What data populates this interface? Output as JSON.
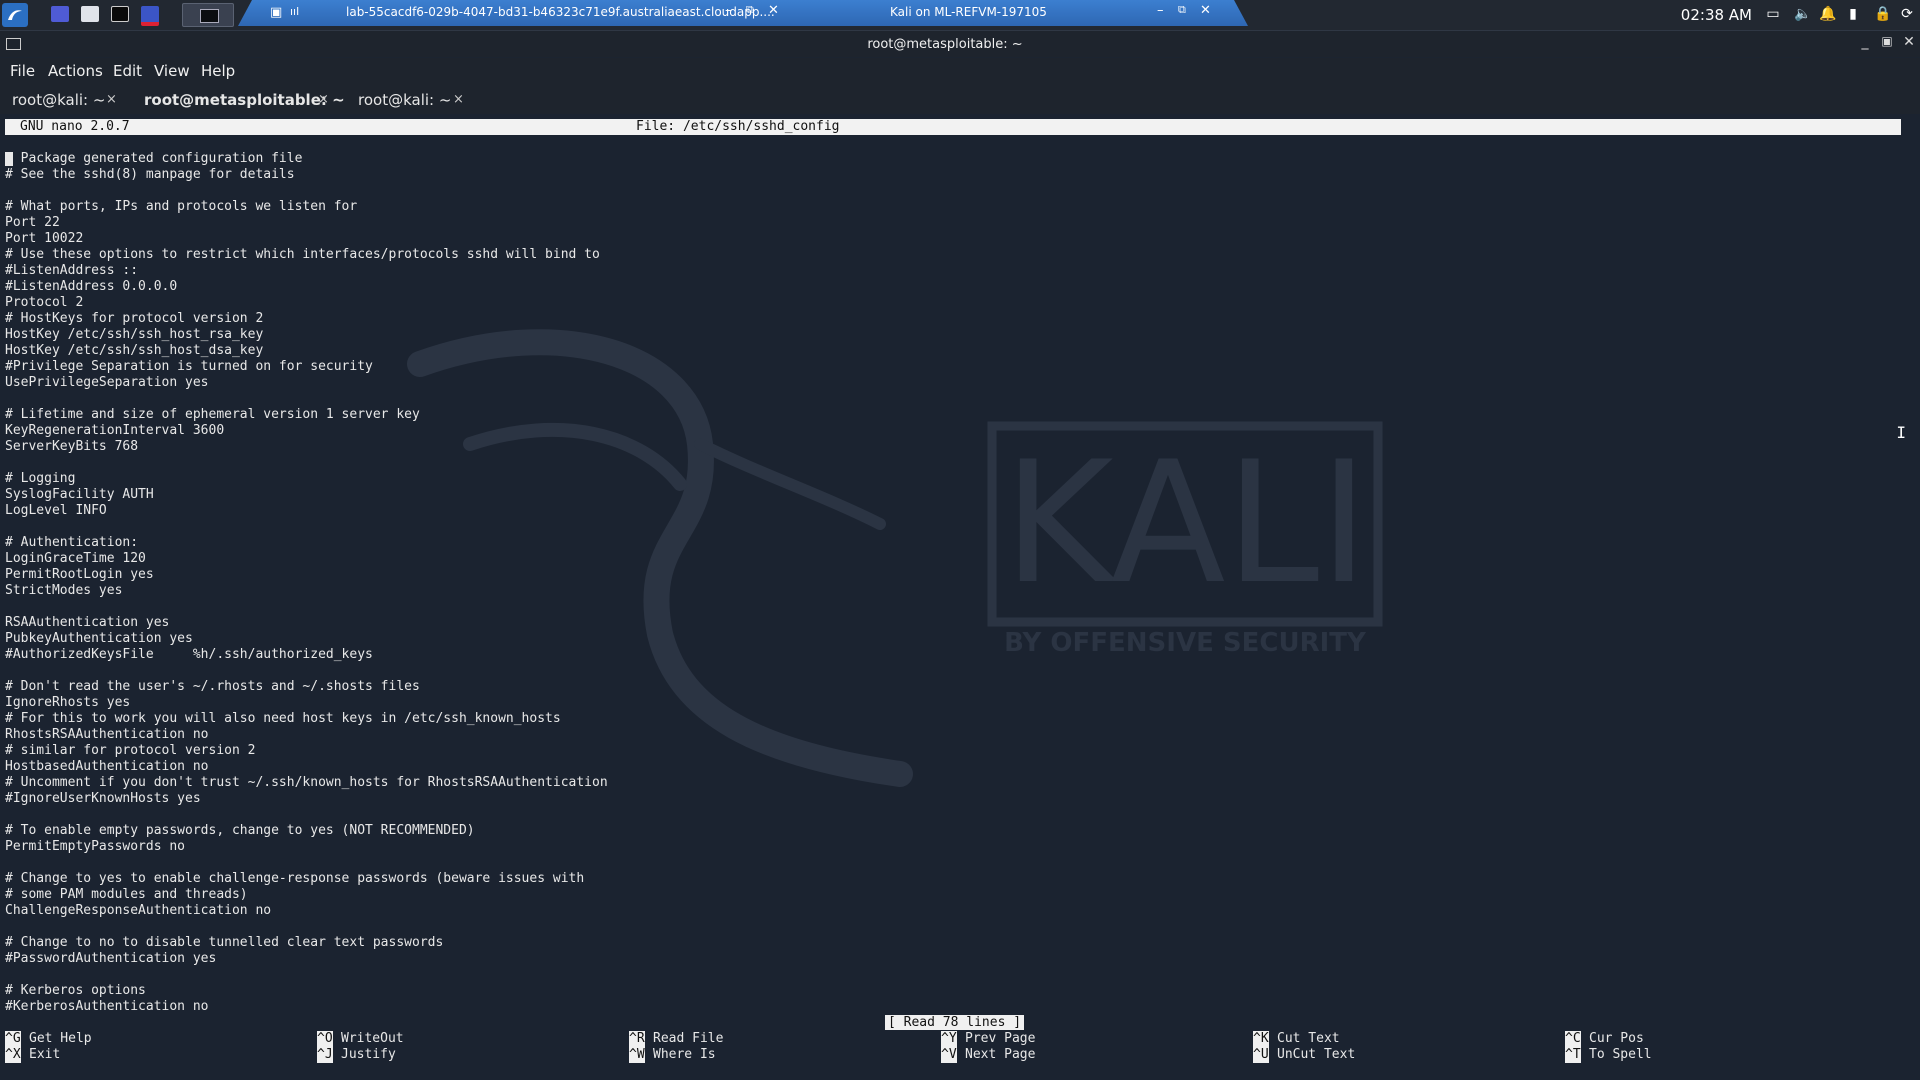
{
  "panel": {
    "vm_tab_title": "lab-55cacdf6-029b-4047-bd31-b46323c71e9f.australiaeast.cloudapp....",
    "vm_window_title": "Kali on ML-REFVM-197105",
    "clock": "02:38 AM"
  },
  "window": {
    "title": "root@metasploitable: ~"
  },
  "menu": {
    "items": [
      "File",
      "Actions",
      "Edit",
      "View",
      "Help"
    ]
  },
  "tabs": [
    {
      "label": "root@kali: ~",
      "active": false
    },
    {
      "label": "root@metasploitable: ~",
      "active": true
    },
    {
      "label": "root@kali: ~",
      "active": false
    }
  ],
  "tab_close_glyph": "×",
  "nano": {
    "version": "GNU nano 2.0.7",
    "file": "File: /etc/ssh/sshd_config",
    "content": "# Package generated configuration file\n# See the sshd(8) manpage for details\n\n# What ports, IPs and protocols we listen for\nPort 22\nPort 10022\n# Use these options to restrict which interfaces/protocols sshd will bind to\n#ListenAddress ::\n#ListenAddress 0.0.0.0\nProtocol 2\n# HostKeys for protocol version 2\nHostKey /etc/ssh/ssh_host_rsa_key\nHostKey /etc/ssh/ssh_host_dsa_key\n#Privilege Separation is turned on for security\nUsePrivilegeSeparation yes\n\n# Lifetime and size of ephemeral version 1 server key\nKeyRegenerationInterval 3600\nServerKeyBits 768\n\n# Logging\nSyslogFacility AUTH\nLogLevel INFO\n\n# Authentication:\nLoginGraceTime 120\nPermitRootLogin yes\nStrictModes yes\n\nRSAAuthentication yes\nPubkeyAuthentication yes\n#AuthorizedKeysFile     %h/.ssh/authorized_keys\n\n# Don't read the user's ~/.rhosts and ~/.shosts files\nIgnoreRhosts yes\n# For this to work you will also need host keys in /etc/ssh_known_hosts\nRhostsRSAAuthentication no\n# similar for protocol version 2\nHostbasedAuthentication no\n# Uncomment if you don't trust ~/.ssh/known_hosts for RhostsRSAAuthentication\n#IgnoreUserKnownHosts yes\n\n# To enable empty passwords, change to yes (NOT RECOMMENDED)\nPermitEmptyPasswords no\n\n# Change to yes to enable challenge-response passwords (beware issues with\n# some PAM modules and threads)\nChallengeResponseAuthentication no\n\n# Change to no to disable tunnelled clear text passwords\n#PasswordAuthentication yes\n\n# Kerberos options\n#KerberosAuthentication no",
    "status": "[ Read 78 lines ]",
    "shortcuts": [
      {
        "key": "^G",
        "label": "Get Help"
      },
      {
        "key": "^X",
        "label": "Exit"
      },
      {
        "key": "^O",
        "label": "WriteOut"
      },
      {
        "key": "^J",
        "label": "Justify"
      },
      {
        "key": "^R",
        "label": "Read File"
      },
      {
        "key": "^W",
        "label": "Where Is"
      },
      {
        "key": "^Y",
        "label": "Prev Page"
      },
      {
        "key": "^V",
        "label": "Next Page"
      },
      {
        "key": "^K",
        "label": "Cut Text"
      },
      {
        "key": "^U",
        "label": "UnCut Text"
      },
      {
        "key": "^C",
        "label": "Cur Pos"
      },
      {
        "key": "^T",
        "label": "To Spell"
      }
    ]
  },
  "wallpaper": {
    "logo_text": "KALI",
    "tagline": "BY OFFENSIVE SECURITY"
  },
  "colors": {
    "terminal_bg": "#1b2330",
    "panel_bg": "#222831",
    "vm_bar": "#3c7fd0",
    "accent": "#4a8fe0"
  }
}
